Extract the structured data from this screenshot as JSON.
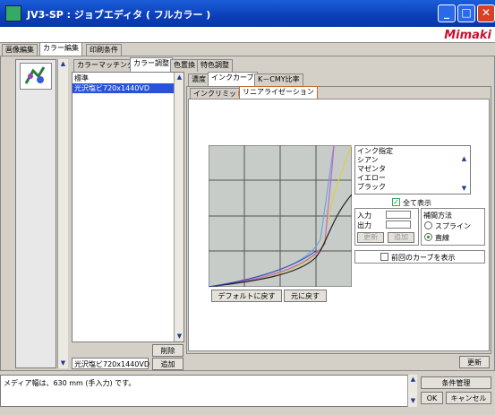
{
  "window": {
    "title": "JV3-SP : ジョブエディタ ( フルカラー )"
  },
  "brand": "Mimaki",
  "main_tabs": [
    {
      "label": "画像編集"
    },
    {
      "label": "カラー編集"
    },
    {
      "label": "印刷条件"
    }
  ],
  "color_tabs": [
    {
      "label": "カラーマッチング"
    },
    {
      "label": "カラー調整"
    },
    {
      "label": "色置換"
    },
    {
      "label": "特色調整"
    }
  ],
  "profile_list": {
    "items": [
      {
        "label": "標準",
        "selected": false
      },
      {
        "label": "光沢塩ビ720x1440VD",
        "selected": true
      }
    ],
    "current": "光沢塩ビ720x1440VD",
    "delete_label": "削除",
    "add_label": "追加"
  },
  "adjust_tabs": [
    {
      "label": "濃度"
    },
    {
      "label": "インクカーブ"
    },
    {
      "label": "K－CMY比率"
    }
  ],
  "subtabs": [
    {
      "label": "インクリミット"
    },
    {
      "label": "リニアライゼーション"
    }
  ],
  "ink": {
    "header": "インク指定",
    "items": [
      "シアン",
      "マゼンタ",
      "イエロー",
      "ブラック"
    ],
    "show_all_label": "全て表示",
    "show_all_checked": true
  },
  "io": {
    "input_label": "入力",
    "output_label": "出力",
    "update_label": "更新",
    "add_label": "追加"
  },
  "interp": {
    "label": "補間方法",
    "options": [
      "スプライン",
      "直線"
    ],
    "selected": "直線"
  },
  "prev_curve": {
    "label": "前回のカーブを表示",
    "checked": false
  },
  "curve_buttons": {
    "default_label": "デフォルトに戻す",
    "restore_label": "元に戻す"
  },
  "update_button": "更新",
  "colors": {
    "cyan": "#6aa8d8",
    "magenta": "#c068c8",
    "yellow": "#d8d040",
    "black": "#202020",
    "blue": "#3040a8"
  },
  "footer": {
    "message": "メディア幅は、630 mm (手入力) です。",
    "conditions_label": "条件管理",
    "ok_label": "OK",
    "cancel_label": "キャンセル"
  }
}
